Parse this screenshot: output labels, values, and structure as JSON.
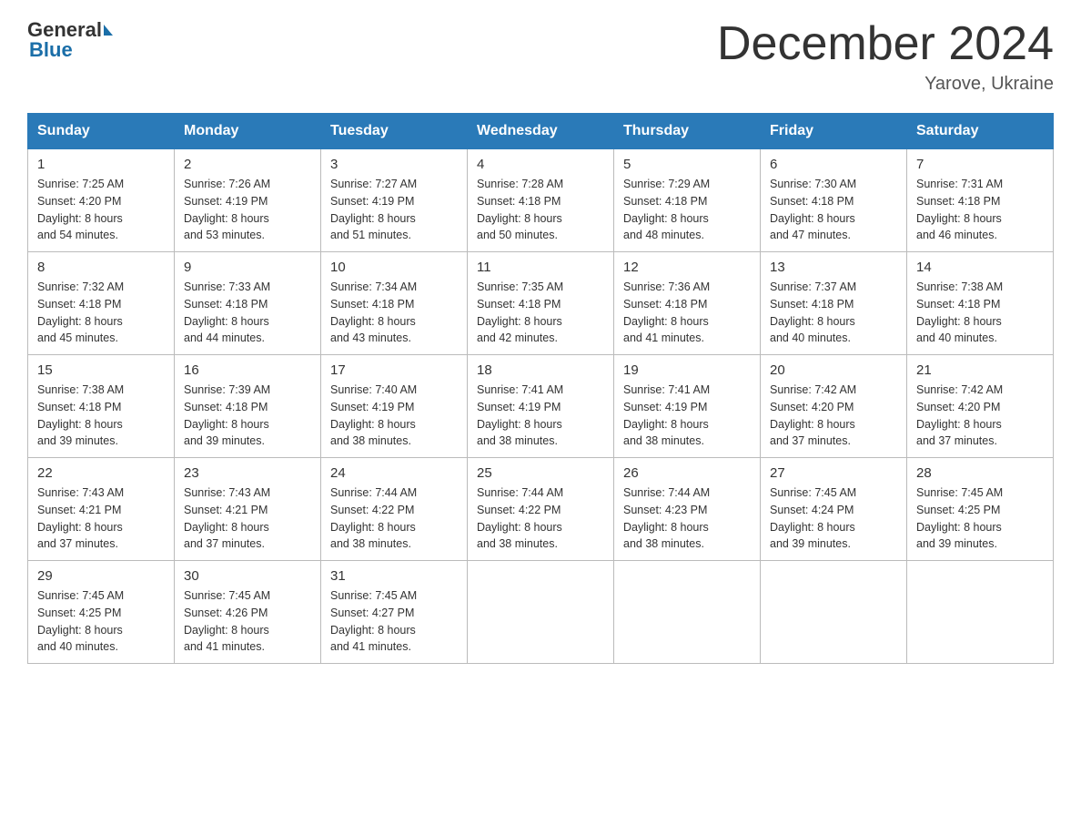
{
  "header": {
    "logo_general": "General",
    "logo_blue": "Blue",
    "month_title": "December 2024",
    "location": "Yarove, Ukraine"
  },
  "weekdays": [
    "Sunday",
    "Monday",
    "Tuesday",
    "Wednesday",
    "Thursday",
    "Friday",
    "Saturday"
  ],
  "weeks": [
    [
      {
        "day": "1",
        "sunrise": "Sunrise: 7:25 AM",
        "sunset": "Sunset: 4:20 PM",
        "daylight": "Daylight: 8 hours",
        "daylight2": "and 54 minutes."
      },
      {
        "day": "2",
        "sunrise": "Sunrise: 7:26 AM",
        "sunset": "Sunset: 4:19 PM",
        "daylight": "Daylight: 8 hours",
        "daylight2": "and 53 minutes."
      },
      {
        "day": "3",
        "sunrise": "Sunrise: 7:27 AM",
        "sunset": "Sunset: 4:19 PM",
        "daylight": "Daylight: 8 hours",
        "daylight2": "and 51 minutes."
      },
      {
        "day": "4",
        "sunrise": "Sunrise: 7:28 AM",
        "sunset": "Sunset: 4:18 PM",
        "daylight": "Daylight: 8 hours",
        "daylight2": "and 50 minutes."
      },
      {
        "day": "5",
        "sunrise": "Sunrise: 7:29 AM",
        "sunset": "Sunset: 4:18 PM",
        "daylight": "Daylight: 8 hours",
        "daylight2": "and 48 minutes."
      },
      {
        "day": "6",
        "sunrise": "Sunrise: 7:30 AM",
        "sunset": "Sunset: 4:18 PM",
        "daylight": "Daylight: 8 hours",
        "daylight2": "and 47 minutes."
      },
      {
        "day": "7",
        "sunrise": "Sunrise: 7:31 AM",
        "sunset": "Sunset: 4:18 PM",
        "daylight": "Daylight: 8 hours",
        "daylight2": "and 46 minutes."
      }
    ],
    [
      {
        "day": "8",
        "sunrise": "Sunrise: 7:32 AM",
        "sunset": "Sunset: 4:18 PM",
        "daylight": "Daylight: 8 hours",
        "daylight2": "and 45 minutes."
      },
      {
        "day": "9",
        "sunrise": "Sunrise: 7:33 AM",
        "sunset": "Sunset: 4:18 PM",
        "daylight": "Daylight: 8 hours",
        "daylight2": "and 44 minutes."
      },
      {
        "day": "10",
        "sunrise": "Sunrise: 7:34 AM",
        "sunset": "Sunset: 4:18 PM",
        "daylight": "Daylight: 8 hours",
        "daylight2": "and 43 minutes."
      },
      {
        "day": "11",
        "sunrise": "Sunrise: 7:35 AM",
        "sunset": "Sunset: 4:18 PM",
        "daylight": "Daylight: 8 hours",
        "daylight2": "and 42 minutes."
      },
      {
        "day": "12",
        "sunrise": "Sunrise: 7:36 AM",
        "sunset": "Sunset: 4:18 PM",
        "daylight": "Daylight: 8 hours",
        "daylight2": "and 41 minutes."
      },
      {
        "day": "13",
        "sunrise": "Sunrise: 7:37 AM",
        "sunset": "Sunset: 4:18 PM",
        "daylight": "Daylight: 8 hours",
        "daylight2": "and 40 minutes."
      },
      {
        "day": "14",
        "sunrise": "Sunrise: 7:38 AM",
        "sunset": "Sunset: 4:18 PM",
        "daylight": "Daylight: 8 hours",
        "daylight2": "and 40 minutes."
      }
    ],
    [
      {
        "day": "15",
        "sunrise": "Sunrise: 7:38 AM",
        "sunset": "Sunset: 4:18 PM",
        "daylight": "Daylight: 8 hours",
        "daylight2": "and 39 minutes."
      },
      {
        "day": "16",
        "sunrise": "Sunrise: 7:39 AM",
        "sunset": "Sunset: 4:18 PM",
        "daylight": "Daylight: 8 hours",
        "daylight2": "and 39 minutes."
      },
      {
        "day": "17",
        "sunrise": "Sunrise: 7:40 AM",
        "sunset": "Sunset: 4:19 PM",
        "daylight": "Daylight: 8 hours",
        "daylight2": "and 38 minutes."
      },
      {
        "day": "18",
        "sunrise": "Sunrise: 7:41 AM",
        "sunset": "Sunset: 4:19 PM",
        "daylight": "Daylight: 8 hours",
        "daylight2": "and 38 minutes."
      },
      {
        "day": "19",
        "sunrise": "Sunrise: 7:41 AM",
        "sunset": "Sunset: 4:19 PM",
        "daylight": "Daylight: 8 hours",
        "daylight2": "and 38 minutes."
      },
      {
        "day": "20",
        "sunrise": "Sunrise: 7:42 AM",
        "sunset": "Sunset: 4:20 PM",
        "daylight": "Daylight: 8 hours",
        "daylight2": "and 37 minutes."
      },
      {
        "day": "21",
        "sunrise": "Sunrise: 7:42 AM",
        "sunset": "Sunset: 4:20 PM",
        "daylight": "Daylight: 8 hours",
        "daylight2": "and 37 minutes."
      }
    ],
    [
      {
        "day": "22",
        "sunrise": "Sunrise: 7:43 AM",
        "sunset": "Sunset: 4:21 PM",
        "daylight": "Daylight: 8 hours",
        "daylight2": "and 37 minutes."
      },
      {
        "day": "23",
        "sunrise": "Sunrise: 7:43 AM",
        "sunset": "Sunset: 4:21 PM",
        "daylight": "Daylight: 8 hours",
        "daylight2": "and 37 minutes."
      },
      {
        "day": "24",
        "sunrise": "Sunrise: 7:44 AM",
        "sunset": "Sunset: 4:22 PM",
        "daylight": "Daylight: 8 hours",
        "daylight2": "and 38 minutes."
      },
      {
        "day": "25",
        "sunrise": "Sunrise: 7:44 AM",
        "sunset": "Sunset: 4:22 PM",
        "daylight": "Daylight: 8 hours",
        "daylight2": "and 38 minutes."
      },
      {
        "day": "26",
        "sunrise": "Sunrise: 7:44 AM",
        "sunset": "Sunset: 4:23 PM",
        "daylight": "Daylight: 8 hours",
        "daylight2": "and 38 minutes."
      },
      {
        "day": "27",
        "sunrise": "Sunrise: 7:45 AM",
        "sunset": "Sunset: 4:24 PM",
        "daylight": "Daylight: 8 hours",
        "daylight2": "and 39 minutes."
      },
      {
        "day": "28",
        "sunrise": "Sunrise: 7:45 AM",
        "sunset": "Sunset: 4:25 PM",
        "daylight": "Daylight: 8 hours",
        "daylight2": "and 39 minutes."
      }
    ],
    [
      {
        "day": "29",
        "sunrise": "Sunrise: 7:45 AM",
        "sunset": "Sunset: 4:25 PM",
        "daylight": "Daylight: 8 hours",
        "daylight2": "and 40 minutes."
      },
      {
        "day": "30",
        "sunrise": "Sunrise: 7:45 AM",
        "sunset": "Sunset: 4:26 PM",
        "daylight": "Daylight: 8 hours",
        "daylight2": "and 41 minutes."
      },
      {
        "day": "31",
        "sunrise": "Sunrise: 7:45 AM",
        "sunset": "Sunset: 4:27 PM",
        "daylight": "Daylight: 8 hours",
        "daylight2": "and 41 minutes."
      },
      null,
      null,
      null,
      null
    ]
  ]
}
